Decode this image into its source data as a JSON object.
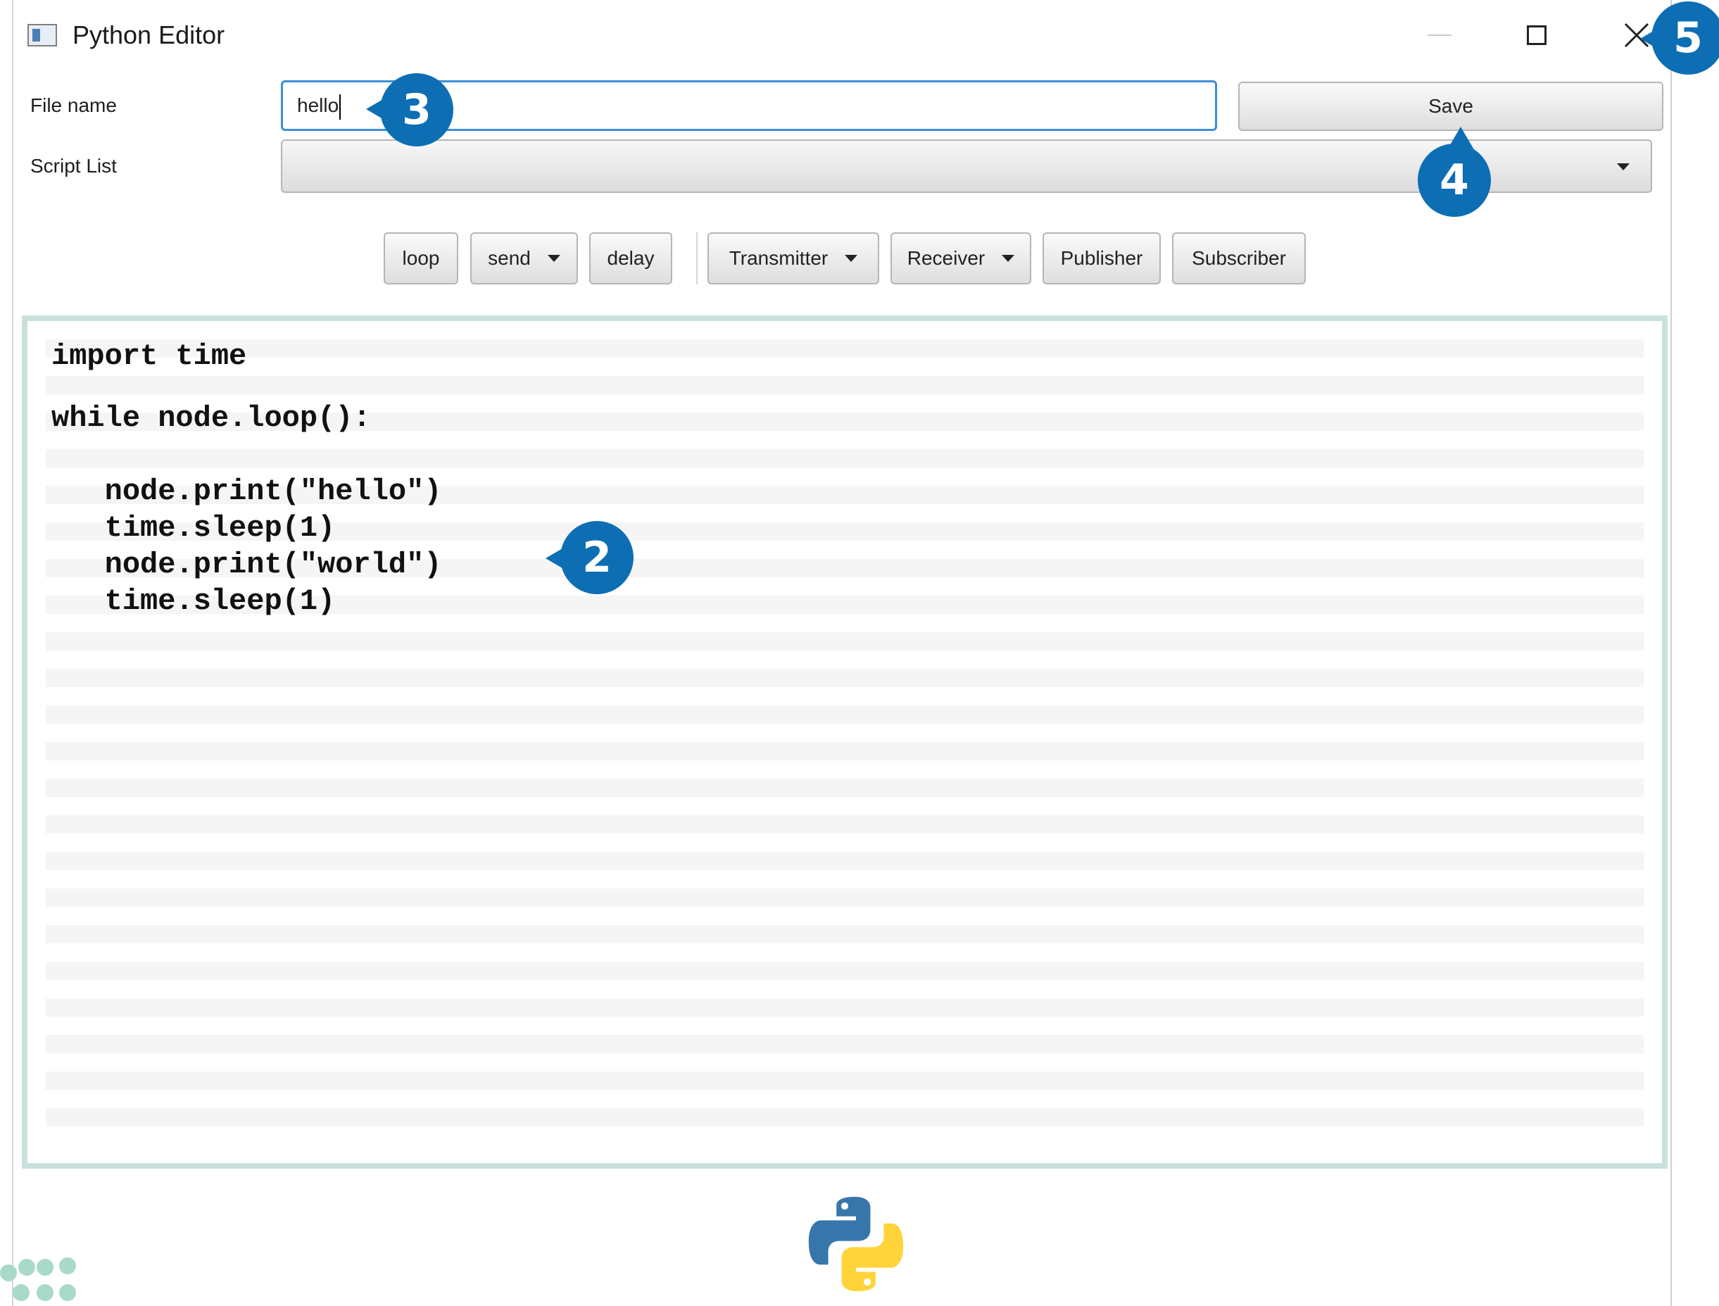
{
  "window": {
    "title": "Python Editor",
    "controls": {
      "minimize": "minimize-icon",
      "maximize": "maximize-icon",
      "close": "close-icon"
    }
  },
  "form": {
    "file_name_label": "File name",
    "file_name_value": "hello",
    "save_label": "Save",
    "script_list_label": "Script List",
    "script_list_value": ""
  },
  "toolbar": {
    "buttons": [
      {
        "label": "loop",
        "dropdown": false
      },
      {
        "label": "send",
        "dropdown": true
      },
      {
        "label": "delay",
        "dropdown": false
      },
      {
        "label": "Transmitter",
        "dropdown": true
      },
      {
        "label": "Receiver",
        "dropdown": true
      },
      {
        "label": "Publisher",
        "dropdown": false
      },
      {
        "label": "Subscriber",
        "dropdown": false
      }
    ]
  },
  "editor": {
    "code_lines": [
      "import time",
      "while node.loop():",
      "",
      "   node.print(\"hello\")",
      "   time.sleep(1)",
      "   node.print(\"world\")",
      "   time.sleep(1)"
    ]
  },
  "callouts": {
    "editor": "2",
    "file_name": "3",
    "save": "4",
    "close": "5"
  },
  "footer": {
    "logo": "python-logo"
  },
  "colors": {
    "callout_blue": "#0d6eb4",
    "input_focus_blue": "#3c8fd6",
    "editor_border": "#c9e1dc",
    "python_blue": "#3776ab",
    "python_yellow": "#ffd43b"
  }
}
